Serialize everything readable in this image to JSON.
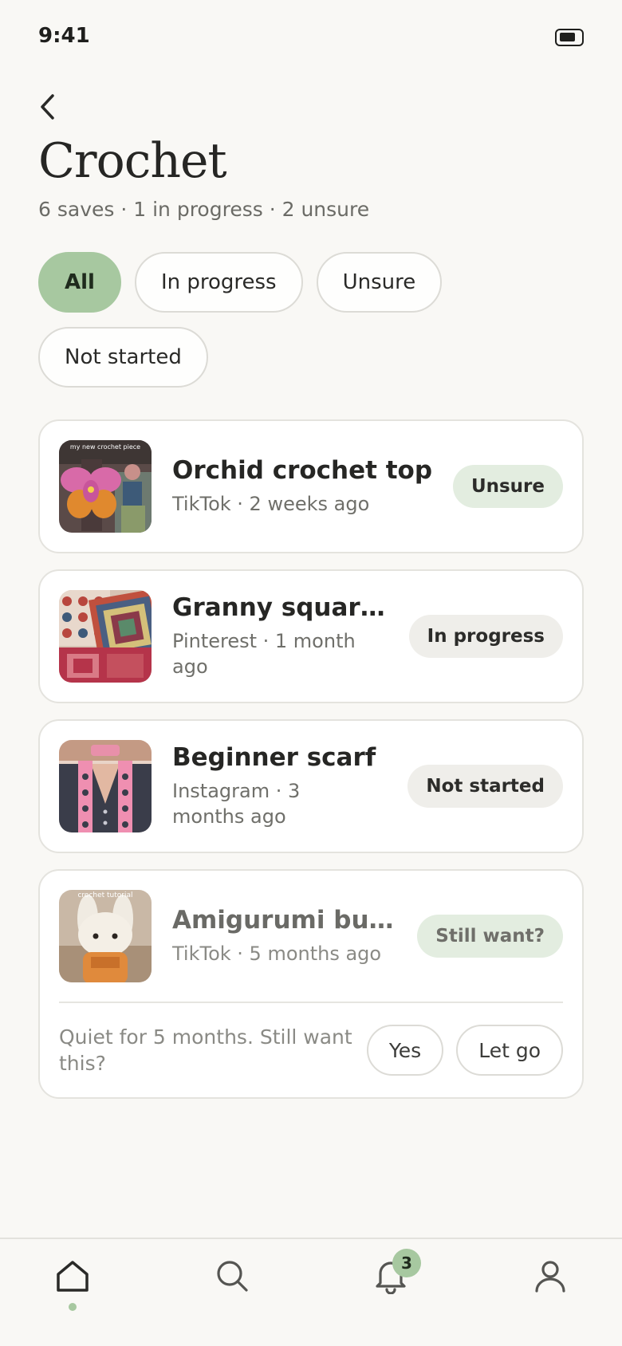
{
  "status_bar": {
    "time": "9:41",
    "battery_icon": "battery-icon"
  },
  "header": {
    "back_icon": "chevron-left-icon",
    "title": "Crochet",
    "subtitle": "6 saves · 1 in progress · 2 unsure"
  },
  "filters": [
    {
      "label": "All",
      "active": true
    },
    {
      "label": "In progress",
      "active": false
    },
    {
      "label": "Unsure",
      "active": false
    },
    {
      "label": "Not started",
      "active": false
    }
  ],
  "items": [
    {
      "title": "Orchid crochet top",
      "meta": "TikTok · 2 weeks ago",
      "status": "Unsure",
      "thumb_caption": "my new crochet piece"
    },
    {
      "title": "Granny square bl...",
      "meta": "Pinterest · 1 month ago",
      "status": "In progress"
    },
    {
      "title": "Beginner scarf",
      "meta": "Instagram · 3 months ago",
      "status": "Not started"
    },
    {
      "title": "Amigurumi bunny",
      "meta": "TikTok · 5 months ago",
      "status": "Still want?",
      "thumb_caption": "crochet tutorial",
      "prompt": "Quiet for 5 months. Still want this?",
      "yes_label": "Yes",
      "let_go_label": "Let go"
    }
  ],
  "tab_bar": {
    "tabs": [
      {
        "name": "home",
        "icon": "home-icon",
        "active": true
      },
      {
        "name": "search",
        "icon": "search-icon",
        "active": false
      },
      {
        "name": "notifications",
        "icon": "bell-icon",
        "active": false,
        "badge": "3"
      },
      {
        "name": "profile",
        "icon": "user-icon",
        "active": false
      }
    ]
  },
  "colors": {
    "accent": "#a7c8a0",
    "background": "#f9f8f5",
    "card": "#ffffff"
  }
}
